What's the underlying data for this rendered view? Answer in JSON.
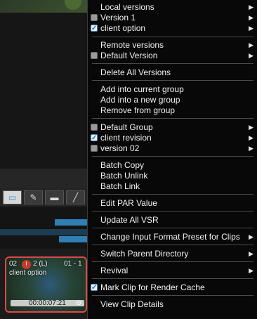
{
  "menu": {
    "local_versions": "Local versions",
    "version_1": "Version 1",
    "client_option": "client option",
    "remote_versions": "Remote versions",
    "default_version": "Default Version",
    "delete_all_versions": "Delete All Versions",
    "add_into_current_group": "Add into current group",
    "add_into_new_group": "Add into a new group",
    "remove_from_group": "Remove from group",
    "default_group": "Default Group",
    "client_revision": "client revision",
    "version_02": "version 02",
    "batch_copy": "Batch Copy",
    "batch_unlink": "Batch Unlink",
    "batch_link": "Batch Link",
    "edit_par_value": "Edit PAR Value",
    "update_all_vsr": "Update All VSR",
    "change_input_format": "Change Input Format Preset for Clips",
    "switch_parent_directory": "Switch Parent Directory",
    "revival": "Revival",
    "mark_clip_render_cache": "Mark Clip for Render Cache",
    "view_clip_details": "View Clip Details"
  },
  "clip": {
    "top_left": "02",
    "top_mid": "2 (L)",
    "top_right": "01 - 1",
    "name": "client option",
    "timecode": "00:00:07:21"
  }
}
